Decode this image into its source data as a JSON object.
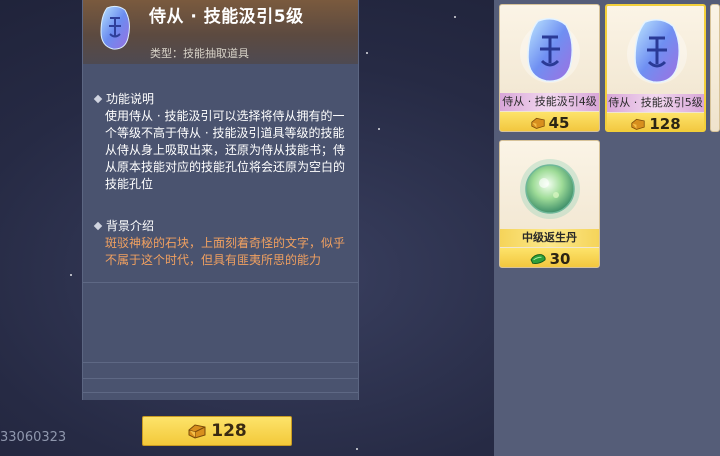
{
  "detail": {
    "title": "侍从 · 技能汲引5级",
    "type_line": "类型：技能抽取道具",
    "function_heading": "功能说明",
    "function_text": "使用侍从 · 技能汲引可以选择将侍从拥有的一个等级不高于侍从 · 技能汲引道具等级的技能从侍从身上吸取出来，还原为侍从技能书；侍从原本技能对应的技能孔位将会还原为空白的技能孔位",
    "background_heading": "背景介绍",
    "background_text": "斑驳神秘的石块，上面刻着奇怪的文字，似乎不属于这个时代，但具有匪夷所思的能力",
    "price": "128",
    "colors": {
      "panel": "#4a536f",
      "header": "#7a5a3e",
      "lore_text": "#f0a060",
      "price_button": "#f3c93a"
    }
  },
  "uid_text": "33060323",
  "inventory": {
    "items": [
      {
        "name": "侍从 · 技能汲引4级",
        "price": "45",
        "icon": "blue-rune-stone-icon",
        "currency_icon": "gold-ingot-icon",
        "selected": false
      },
      {
        "name": "侍从 · 技能汲引5级",
        "price": "128",
        "icon": "blue-rune-stone-icon",
        "currency_icon": "gold-ingot-icon",
        "selected": true
      },
      {
        "name": "中级返生丹",
        "price": "30",
        "icon": "green-pill-orb-icon",
        "currency_icon": "green-jade-icon",
        "selected": false
      }
    ]
  }
}
